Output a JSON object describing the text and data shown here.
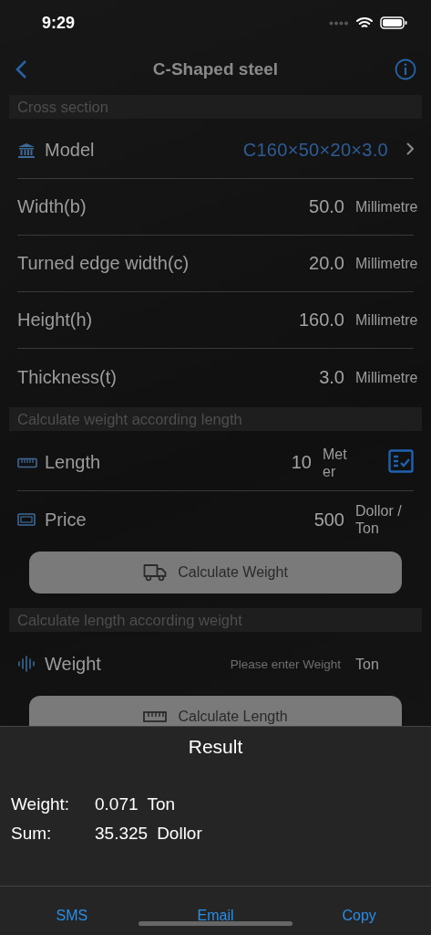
{
  "status_bar": {
    "time": "9:29"
  },
  "nav": {
    "title": "C-Shaped steel"
  },
  "sections": [
    {
      "header": "Cross section",
      "rows": [
        {
          "kind": "model",
          "label": "Model",
          "value": "C160×50×20×3.0"
        },
        {
          "kind": "dimension",
          "label": "Width(b)",
          "value": "50.0",
          "unit": "Millimetre"
        },
        {
          "kind": "dimension",
          "label": "Turned edge width(c)",
          "value": "20.0",
          "unit": "Millimetre"
        },
        {
          "kind": "dimension",
          "label": "Height(h)",
          "value": "160.0",
          "unit": "Millimetre"
        },
        {
          "kind": "dimension",
          "label": "Thickness(t)",
          "value": "3.0",
          "unit": "Millimetre"
        }
      ]
    },
    {
      "header": "Calculate weight according length",
      "rows": [
        {
          "kind": "length",
          "label": "Length",
          "value": "10",
          "unit": "Meter"
        },
        {
          "kind": "price",
          "label": "Price",
          "value": "500",
          "unit": "Dollor / Ton"
        }
      ],
      "button": {
        "kind": "truck",
        "label": "Calculate Weight"
      }
    },
    {
      "header": "Calculate length according weight",
      "rows": [
        {
          "kind": "weight",
          "label": "Weight",
          "placeholder": "Please enter Weight",
          "unit": "Ton"
        }
      ],
      "button": {
        "kind": "ruler",
        "label": "Calculate Length"
      }
    }
  ],
  "result": {
    "title": "Result",
    "lines": [
      {
        "label": "Weight:",
        "value": "0.071",
        "unit": "Ton"
      },
      {
        "label": "Sum:",
        "value": "35.325",
        "unit": "Dollor"
      }
    ],
    "actions": [
      "SMS",
      "Email",
      "Copy"
    ]
  }
}
